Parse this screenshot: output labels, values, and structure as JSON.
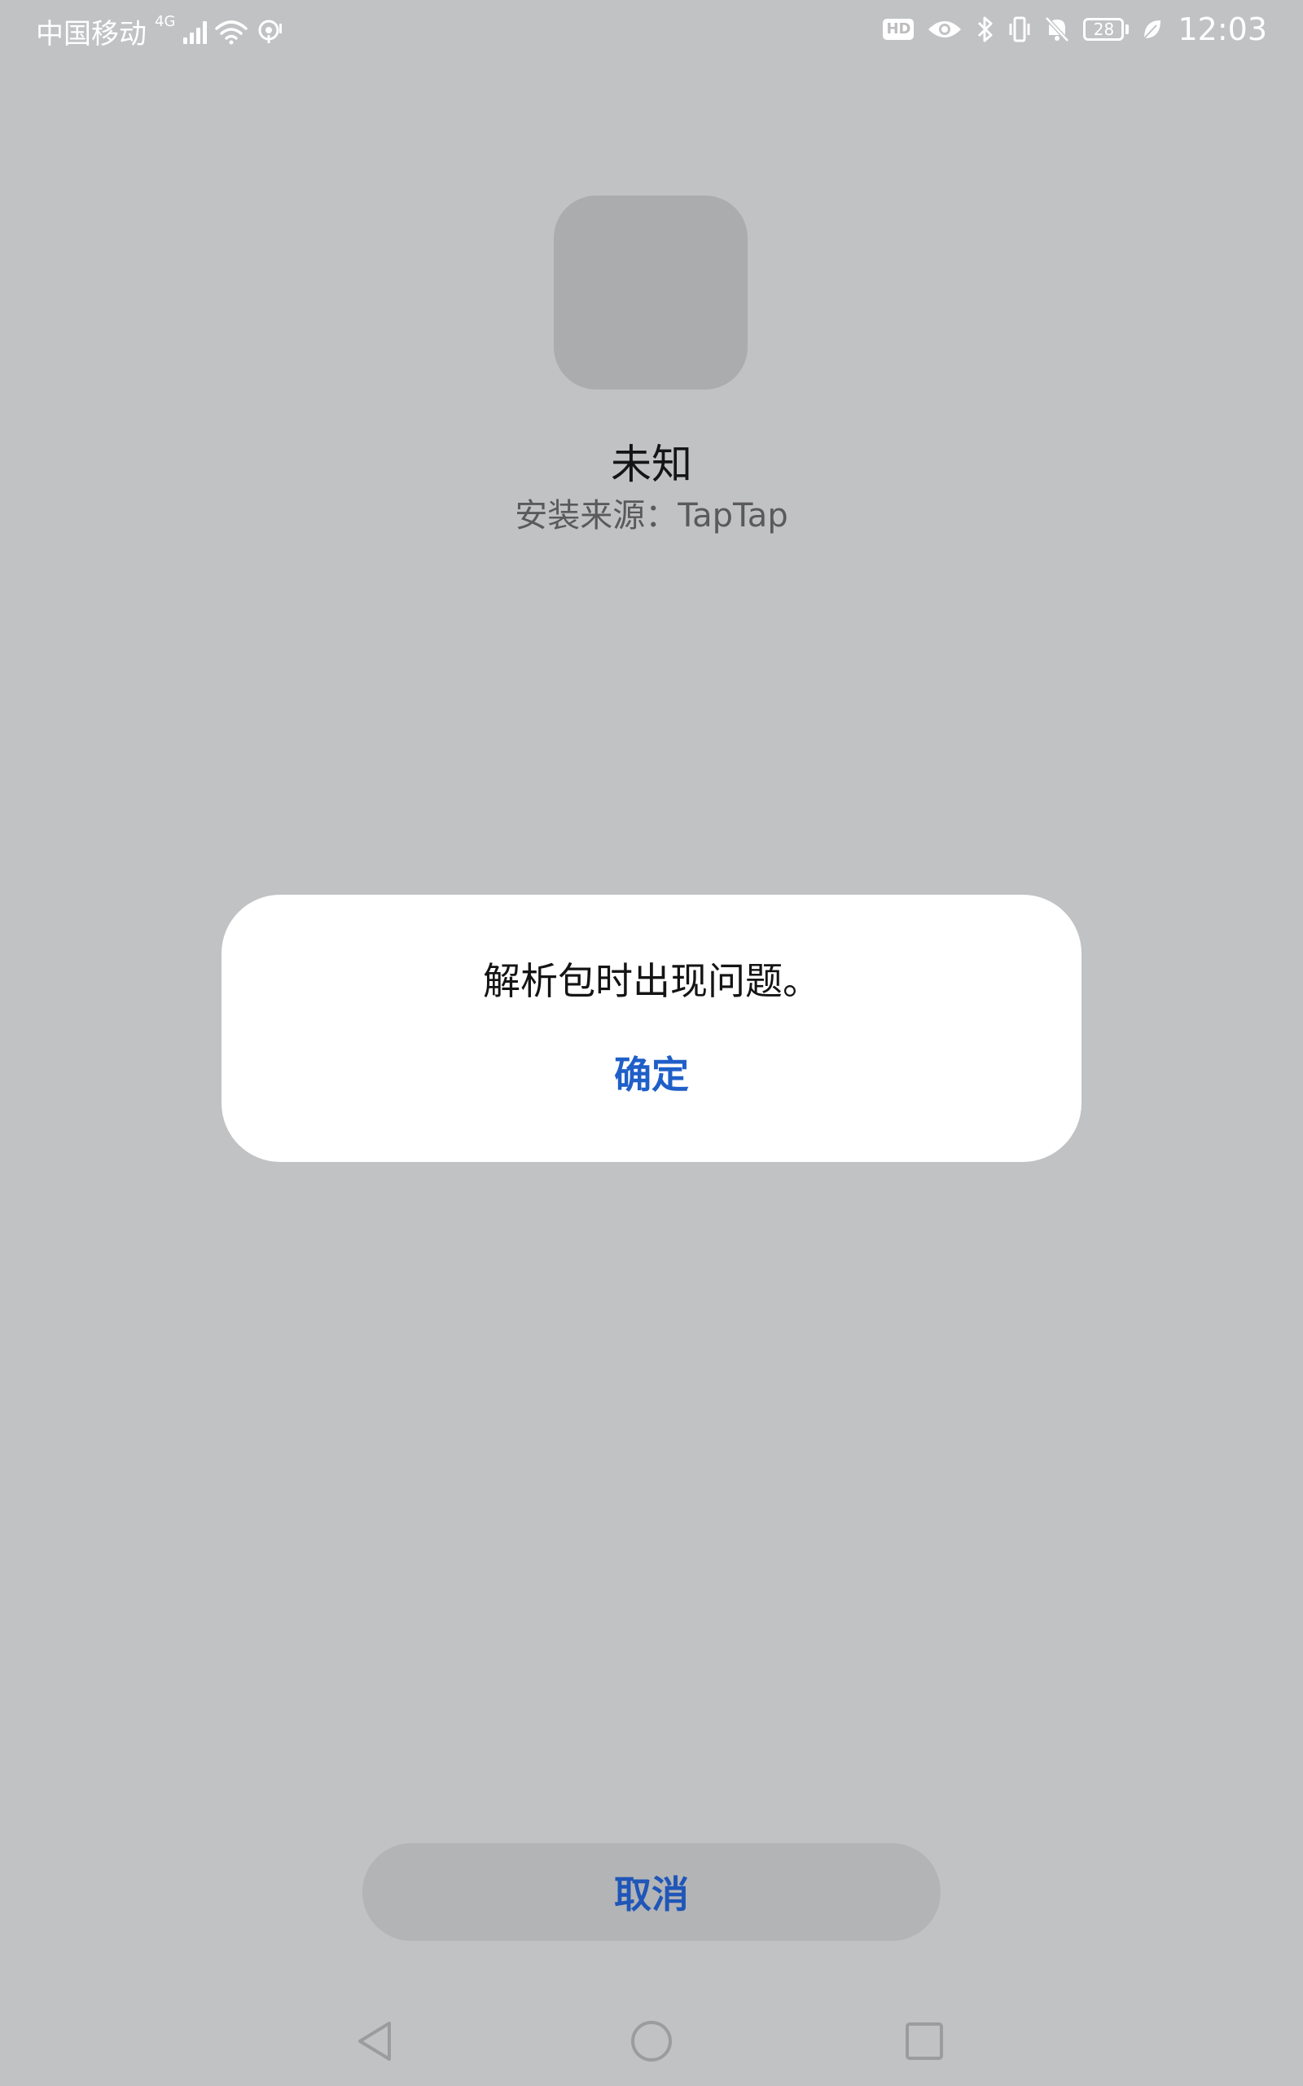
{
  "status_bar": {
    "carrier": "中国移动",
    "network": "4G",
    "battery": "28",
    "time": "12:03",
    "hd_badge": "HD",
    "icons": [
      "signal-icon",
      "wifi-icon",
      "hotspot-icon",
      "hd-icon",
      "eye-icon",
      "bluetooth-icon",
      "vibrate-icon",
      "mute-icon",
      "battery-icon",
      "leaf-icon"
    ]
  },
  "app": {
    "name": "未知",
    "source": "安装来源：TapTap"
  },
  "dialog": {
    "message": "解析包时出现问题。",
    "ok_label": "确定"
  },
  "footer": {
    "cancel_label": "取消"
  },
  "nav": {
    "icons": [
      "back-icon",
      "home-icon",
      "recents-icon"
    ]
  },
  "colors": {
    "background": "#c1c2c4",
    "accent": "#1f5fc8",
    "dialog_bg": "#ffffff",
    "placeholder_icon": "#abacae"
  }
}
